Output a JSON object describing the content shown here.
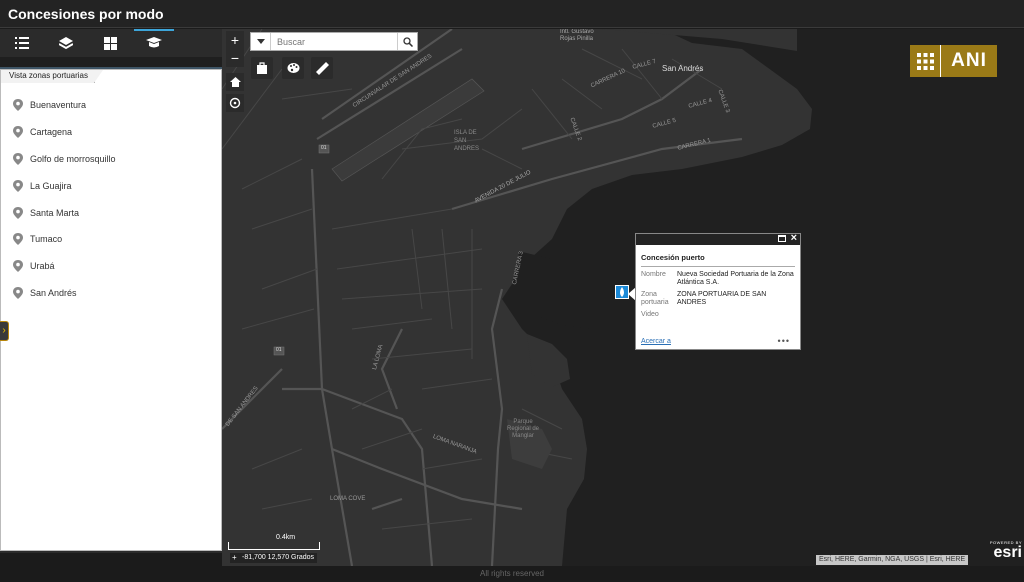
{
  "app": {
    "title": "Concesiones por modo"
  },
  "sidebar": {
    "tabs": [
      {
        "name": "legend",
        "icon": "list-icon"
      },
      {
        "name": "layers",
        "icon": "layers-icon"
      },
      {
        "name": "basemap",
        "icon": "grid-icon"
      },
      {
        "name": "bookmarks",
        "icon": "graduation-cap-icon",
        "active": true
      }
    ],
    "panel_tab": "Vista zonas portuarias",
    "zones": [
      {
        "label": "Buenaventura"
      },
      {
        "label": "Cartagena"
      },
      {
        "label": "Golfo de morrosquillo"
      },
      {
        "label": "La Guajira"
      },
      {
        "label": "Santa Marta"
      },
      {
        "label": "Tumaco"
      },
      {
        "label": "Urabá"
      },
      {
        "label": "San Andrés"
      }
    ],
    "collapse_label": "◂◂"
  },
  "map": {
    "search_placeholder": "Buscar",
    "zoom_in": "+",
    "zoom_out": "−",
    "labels": {
      "san_andres": "San Andrés",
      "intl_airport": "Intl. Gustavo Rojas Pinilla",
      "isla": "ISLA DE SAN ANDRES",
      "avenida": "AVENIDA 20 DE JULIO",
      "circunvalar": "CIRCUNVALAR DE SAN ANDRES",
      "carrera10": "CARRERA 10",
      "carrera1": "CARRERA 1",
      "carrera3": "CARRERA 3",
      "calle4": "CALLE 4",
      "calle3": "CALLE 3",
      "calle2": "CALLE 2",
      "calle7": "CALLE 7",
      "calle5": "CALLE 5",
      "la_loma": "LA LOMA",
      "loma_naranja": "LOMA NARANJA",
      "loma_cove": "LOMA COVE",
      "parque": "Parque Regional de Manglar",
      "road_de_san_andres": "DE SAN ANDRES",
      "shield1": "01",
      "shield2": "01"
    },
    "logo_text": "ANI",
    "scale_label": "0.4km",
    "coordinates": "-81,700 12,570 Grados",
    "attribution": "Esri, HERE, Garmin, NGA, USGS | Esri, HERE",
    "esri_powered": "POWERED BY",
    "esri_word": "esri"
  },
  "popup": {
    "title": "Concesión puerto",
    "fields": [
      {
        "key": "Nombre",
        "value": "Nueva Sociedad Portuaria de la Zona Atlántica S.A."
      },
      {
        "key": "Zona portuaria",
        "value": "ZONA PORTUARIA DE SAN ANDRES"
      },
      {
        "key": "Video",
        "value": ""
      }
    ],
    "zoom_link": "Acercar a",
    "more": "•••"
  },
  "footer": {
    "text": "All rights reserved"
  },
  "colors": {
    "accent": "#3da5d9",
    "brand": "#9a7a17",
    "marker": "#1c8ad8",
    "link": "#2a6fb5"
  }
}
